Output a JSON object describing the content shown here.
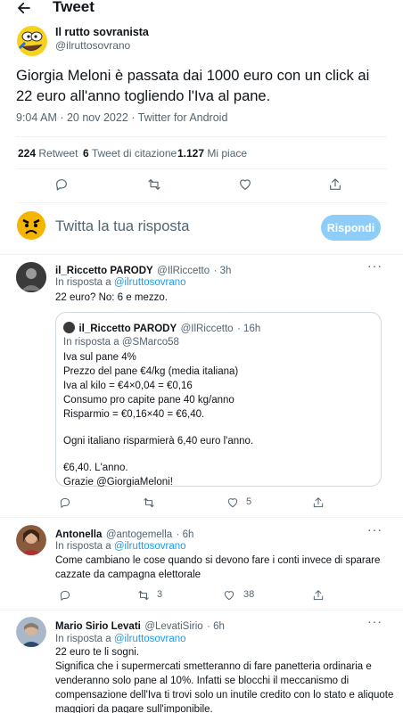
{
  "header": {
    "title": "Tweet",
    "back_icon": "arrow-left-icon"
  },
  "main_tweet": {
    "author_name": "Il rutto sovranista",
    "author_handle": "@ilruttosovrano",
    "text": "Giorgia Meloni è passata dai 1000 euro con un click ai 22 euro all'anno togliendo l'Iva al pane.",
    "meta": "9:04 AM · 20 nov 2022 · Twitter for Android",
    "retweets_count": "224",
    "retweets_label": "Retweet",
    "quotes_count": "6",
    "quotes_label": "Tweet di citazione",
    "likes_count": "1.127",
    "likes_label": "Mi piace"
  },
  "compose": {
    "placeholder": "Twitta la tua risposta",
    "button": "Rispondi"
  },
  "replies": [
    {
      "name": "il_Riccetto PARODY",
      "handle": "@IlRiccetto",
      "time": "· 3h",
      "reply_prefix": "In risposta a",
      "reply_to": "@ilruttosovrano",
      "text": "22 euro? No: 6 e mezzo.",
      "quote": {
        "name": "il_Riccetto PARODY",
        "handle": "@IlRiccetto",
        "time": "· 16h",
        "reply_prefix": "In risposta a",
        "reply_to": "@SMarco58",
        "lines": [
          "Iva sul pane 4%",
          "Prezzo del pane €4/kg (media italiana)",
          "Iva al kilo = €4×0,04 = €0,16",
          "Consumo pro capite pane 40 kg/anno",
          "Risparmio = €0,16×40 = €6,40."
        ],
        "line2": "Ogni italiano risparmierà 6,40 euro l'anno.",
        "line3": "€6,40. L'anno.",
        "line4": "Grazie @GiorgiaMeloni!"
      },
      "likes": "5"
    },
    {
      "name": "Antonella",
      "handle": "@antogemella",
      "time": "· 6h",
      "reply_prefix": "In risposta a",
      "reply_to": "@ilruttosovrano",
      "text_lines": [
        "Come cambiano le cose quando si devono fare i conti invece di sparare",
        "cazzate da campagna elettorale"
      ],
      "retweets": "3",
      "likes": "38"
    },
    {
      "name": "Mario Sirio Levati",
      "handle": "@LevatiSirio",
      "time": "· 6h",
      "reply_prefix": "In risposta a",
      "reply_to": "@ilruttosovrano",
      "text_lines": [
        "22 euro te li sogni.",
        "Significa che i supermercati smetteranno di fare panetteria ordinaria e",
        "venderanno solo pane al 10%. Infatti se blocchi il meccanismo di",
        "compensazione dell'Iva ti trovi solo un inutile credito con lo stato e aliquote",
        "maggiori da pagare sull'imponibile."
      ]
    }
  ]
}
